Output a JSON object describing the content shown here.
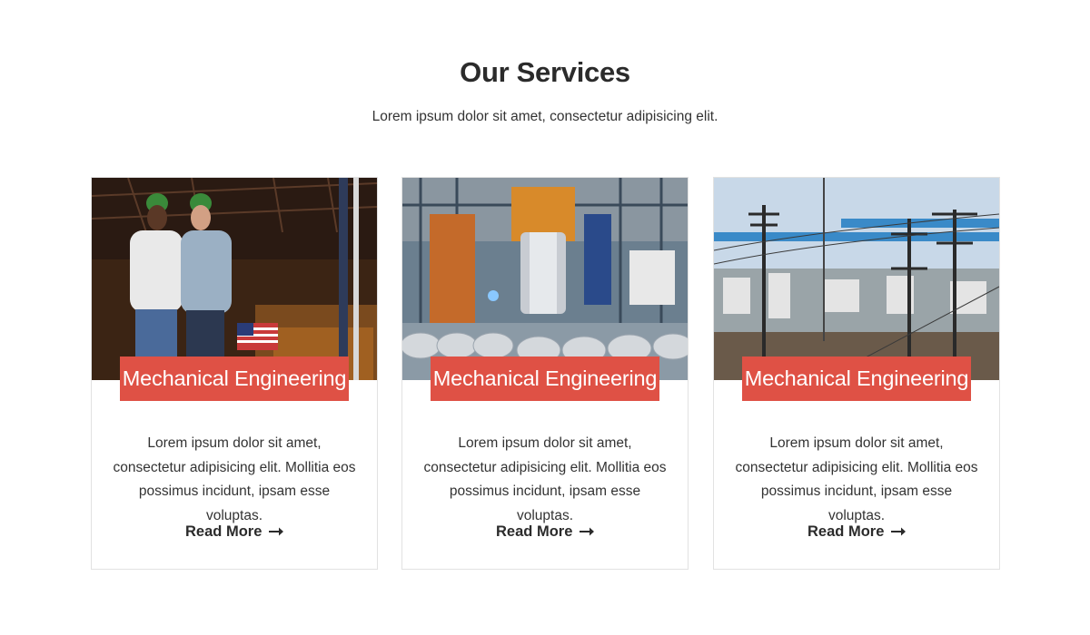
{
  "section": {
    "title": "Our Services",
    "subtitle": "Lorem ipsum dolor sit amet, consectetur adipisicing elit."
  },
  "cards": [
    {
      "image": "steelworkers-in-hard-hats-photo",
      "title": "Mechanical Engineering",
      "text": "Lorem ipsum dolor sit amet, consectetur adipisicing elit. Mollitia eos possimus incidunt, ipsam esse voluptas.",
      "link": "Read More",
      "link_icon": "arrow-right-icon"
    },
    {
      "image": "steel-coil-factory-photo",
      "title": "Mechanical Engineering",
      "text": "Lorem ipsum dolor sit amet, consectetur adipisicing elit. Mollitia eos possimus incidunt, ipsam esse voluptas.",
      "link": "Read More",
      "link_icon": "arrow-right-icon"
    },
    {
      "image": "rail-yard-power-lines-photo",
      "title": "Mechanical Engineering",
      "text": "Lorem ipsum dolor sit amet, consectetur adipisicing elit. Mollitia eos possimus incidunt, ipsam esse voluptas.",
      "link": "Read More",
      "link_icon": "arrow-right-icon"
    }
  ],
  "colors": {
    "accent": "#df5145",
    "heading": "#2b2b2b",
    "text": "#333333",
    "border": "#e2e2e2"
  }
}
